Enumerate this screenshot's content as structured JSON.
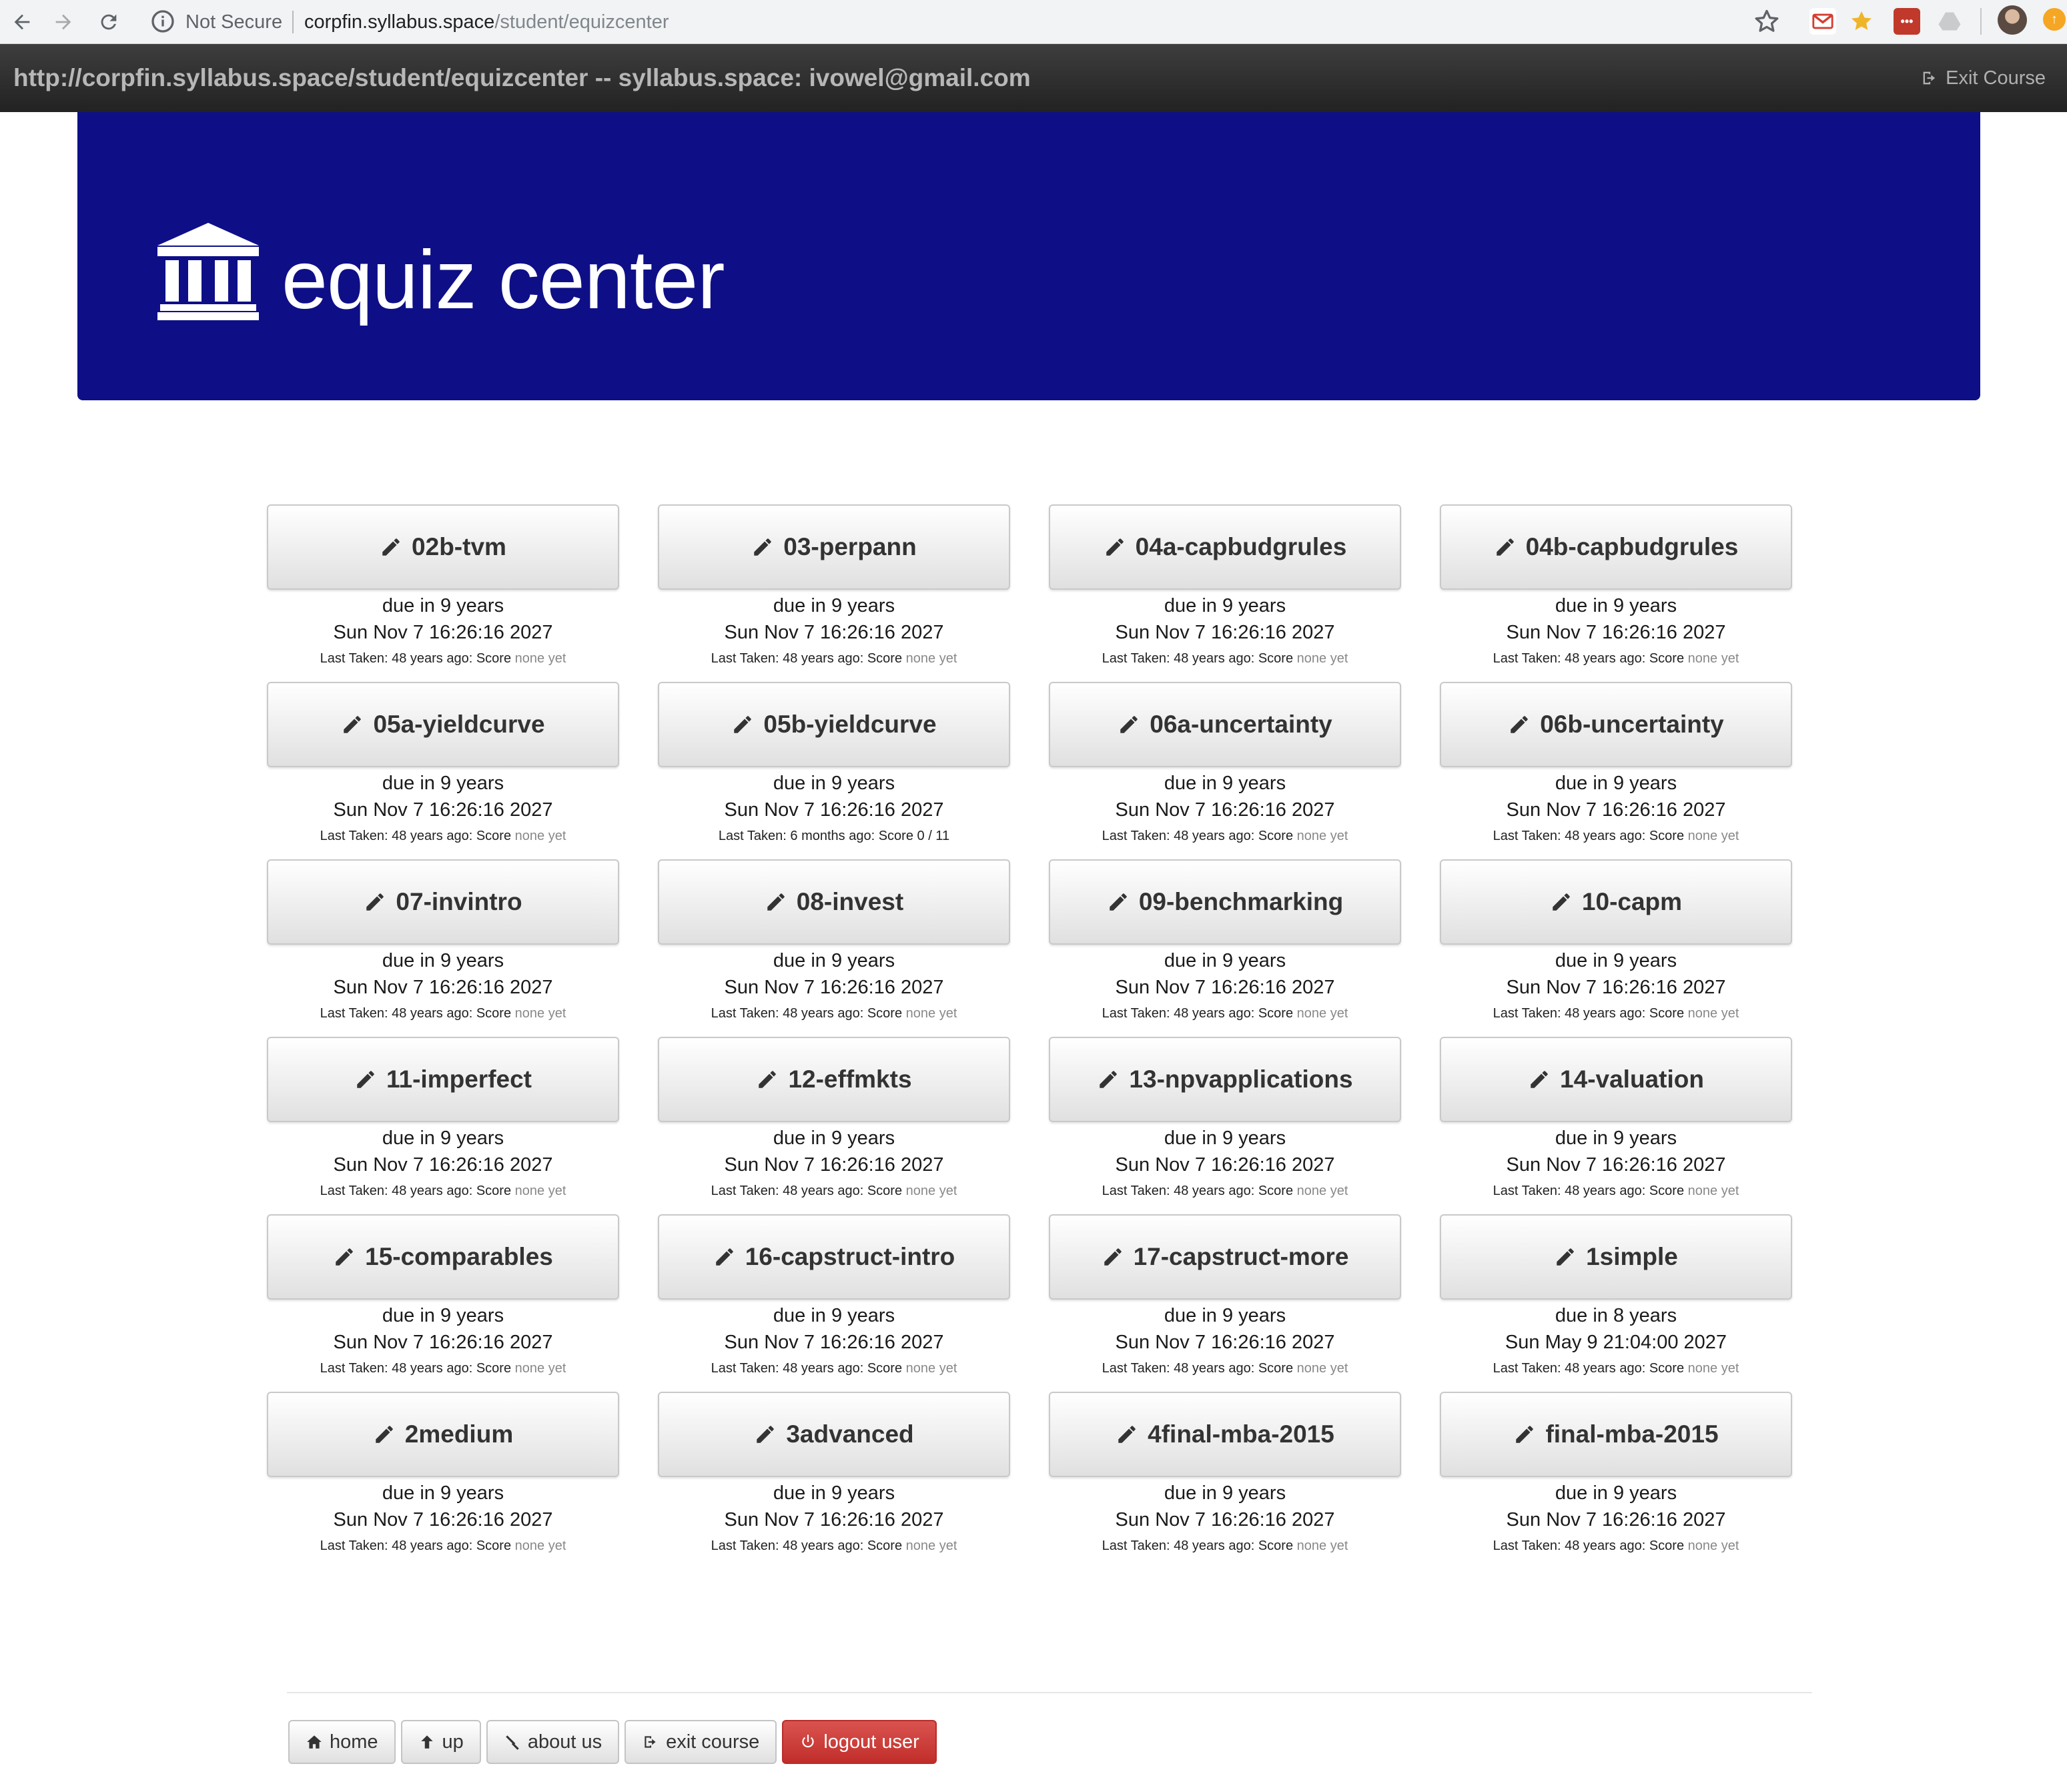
{
  "browser": {
    "security_label": "Not Secure",
    "url_host": "corpfin.syllabus.space",
    "url_path": "/student/equizcenter"
  },
  "topbar": {
    "title": "http://corpfin.syllabus.space/student/equizcenter -- syllabus.space: ivowel@gmail.com",
    "exit_label": "Exit Course"
  },
  "header": {
    "title": "equiz center",
    "icon": "institution-icon"
  },
  "quizzes": [
    {
      "name": "02b-tvm",
      "due": "due in 9 years",
      "date": "Sun Nov 7 16:26:16 2027",
      "last_prefix": "Last Taken: 48 years ago: Score",
      "score": "none yet"
    },
    {
      "name": "03-perpann",
      "due": "due in 9 years",
      "date": "Sun Nov 7 16:26:16 2027",
      "last_prefix": "Last Taken: 48 years ago: Score",
      "score": "none yet"
    },
    {
      "name": "04a-capbudgrules",
      "due": "due in 9 years",
      "date": "Sun Nov 7 16:26:16 2027",
      "last_prefix": "Last Taken: 48 years ago: Score",
      "score": "none yet"
    },
    {
      "name": "04b-capbudgrules",
      "due": "due in 9 years",
      "date": "Sun Nov 7 16:26:16 2027",
      "last_prefix": "Last Taken: 48 years ago: Score",
      "score": "none yet"
    },
    {
      "name": "05a-yieldcurve",
      "due": "due in 9 years",
      "date": "Sun Nov 7 16:26:16 2027",
      "last_prefix": "Last Taken: 48 years ago: Score",
      "score": "none yet"
    },
    {
      "name": "05b-yieldcurve",
      "due": "due in 9 years",
      "date": "Sun Nov 7 16:26:16 2027",
      "last_prefix": "Last Taken: 6 months ago: Score 0 / 11",
      "score": ""
    },
    {
      "name": "06a-uncertainty",
      "due": "due in 9 years",
      "date": "Sun Nov 7 16:26:16 2027",
      "last_prefix": "Last Taken: 48 years ago: Score",
      "score": "none yet"
    },
    {
      "name": "06b-uncertainty",
      "due": "due in 9 years",
      "date": "Sun Nov 7 16:26:16 2027",
      "last_prefix": "Last Taken: 48 years ago: Score",
      "score": "none yet"
    },
    {
      "name": "07-invintro",
      "due": "due in 9 years",
      "date": "Sun Nov 7 16:26:16 2027",
      "last_prefix": "Last Taken: 48 years ago: Score",
      "score": "none yet"
    },
    {
      "name": "08-invest",
      "due": "due in 9 years",
      "date": "Sun Nov 7 16:26:16 2027",
      "last_prefix": "Last Taken: 48 years ago: Score",
      "score": "none yet"
    },
    {
      "name": "09-benchmarking",
      "due": "due in 9 years",
      "date": "Sun Nov 7 16:26:16 2027",
      "last_prefix": "Last Taken: 48 years ago: Score",
      "score": "none yet"
    },
    {
      "name": "10-capm",
      "due": "due in 9 years",
      "date": "Sun Nov 7 16:26:16 2027",
      "last_prefix": "Last Taken: 48 years ago: Score",
      "score": "none yet"
    },
    {
      "name": "11-imperfect",
      "due": "due in 9 years",
      "date": "Sun Nov 7 16:26:16 2027",
      "last_prefix": "Last Taken: 48 years ago: Score",
      "score": "none yet"
    },
    {
      "name": "12-effmkts",
      "due": "due in 9 years",
      "date": "Sun Nov 7 16:26:16 2027",
      "last_prefix": "Last Taken: 48 years ago: Score",
      "score": "none yet"
    },
    {
      "name": "13-npvapplications",
      "due": "due in 9 years",
      "date": "Sun Nov 7 16:26:16 2027",
      "last_prefix": "Last Taken: 48 years ago: Score",
      "score": "none yet"
    },
    {
      "name": "14-valuation",
      "due": "due in 9 years",
      "date": "Sun Nov 7 16:26:16 2027",
      "last_prefix": "Last Taken: 48 years ago: Score",
      "score": "none yet"
    },
    {
      "name": "15-comparables",
      "due": "due in 9 years",
      "date": "Sun Nov 7 16:26:16 2027",
      "last_prefix": "Last Taken: 48 years ago: Score",
      "score": "none yet"
    },
    {
      "name": "16-capstruct-intro",
      "due": "due in 9 years",
      "date": "Sun Nov 7 16:26:16 2027",
      "last_prefix": "Last Taken: 48 years ago: Score",
      "score": "none yet"
    },
    {
      "name": "17-capstruct-more",
      "due": "due in 9 years",
      "date": "Sun Nov 7 16:26:16 2027",
      "last_prefix": "Last Taken: 48 years ago: Score",
      "score": "none yet"
    },
    {
      "name": "1simple",
      "due": "due in 8 years",
      "date": "Sun May 9 21:04:00 2027",
      "last_prefix": "Last Taken: 48 years ago: Score",
      "score": "none yet"
    },
    {
      "name": "2medium",
      "due": "due in 9 years",
      "date": "Sun Nov 7 16:26:16 2027",
      "last_prefix": "Last Taken: 48 years ago: Score",
      "score": "none yet"
    },
    {
      "name": "3advanced",
      "due": "due in 9 years",
      "date": "Sun Nov 7 16:26:16 2027",
      "last_prefix": "Last Taken: 48 years ago: Score",
      "score": "none yet"
    },
    {
      "name": "4final-mba-2015",
      "due": "due in 9 years",
      "date": "Sun Nov 7 16:26:16 2027",
      "last_prefix": "Last Taken: 48 years ago: Score",
      "score": "none yet"
    },
    {
      "name": "final-mba-2015",
      "due": "due in 9 years",
      "date": "Sun Nov 7 16:26:16 2027",
      "last_prefix": "Last Taken: 48 years ago: Score",
      "score": "none yet"
    }
  ],
  "footer": {
    "buttons": [
      {
        "label": "home",
        "icon": "home-icon"
      },
      {
        "label": "up",
        "icon": "arrow-up-icon"
      },
      {
        "label": "about us",
        "icon": "gavel-icon"
      },
      {
        "label": "exit course",
        "icon": "sign-out-icon"
      },
      {
        "label": "logout user",
        "icon": "power-icon"
      }
    ]
  },
  "colors": {
    "jumbotron": "#0e0f87",
    "topbar": "#2a2a2a",
    "logout": "#d9534f"
  }
}
